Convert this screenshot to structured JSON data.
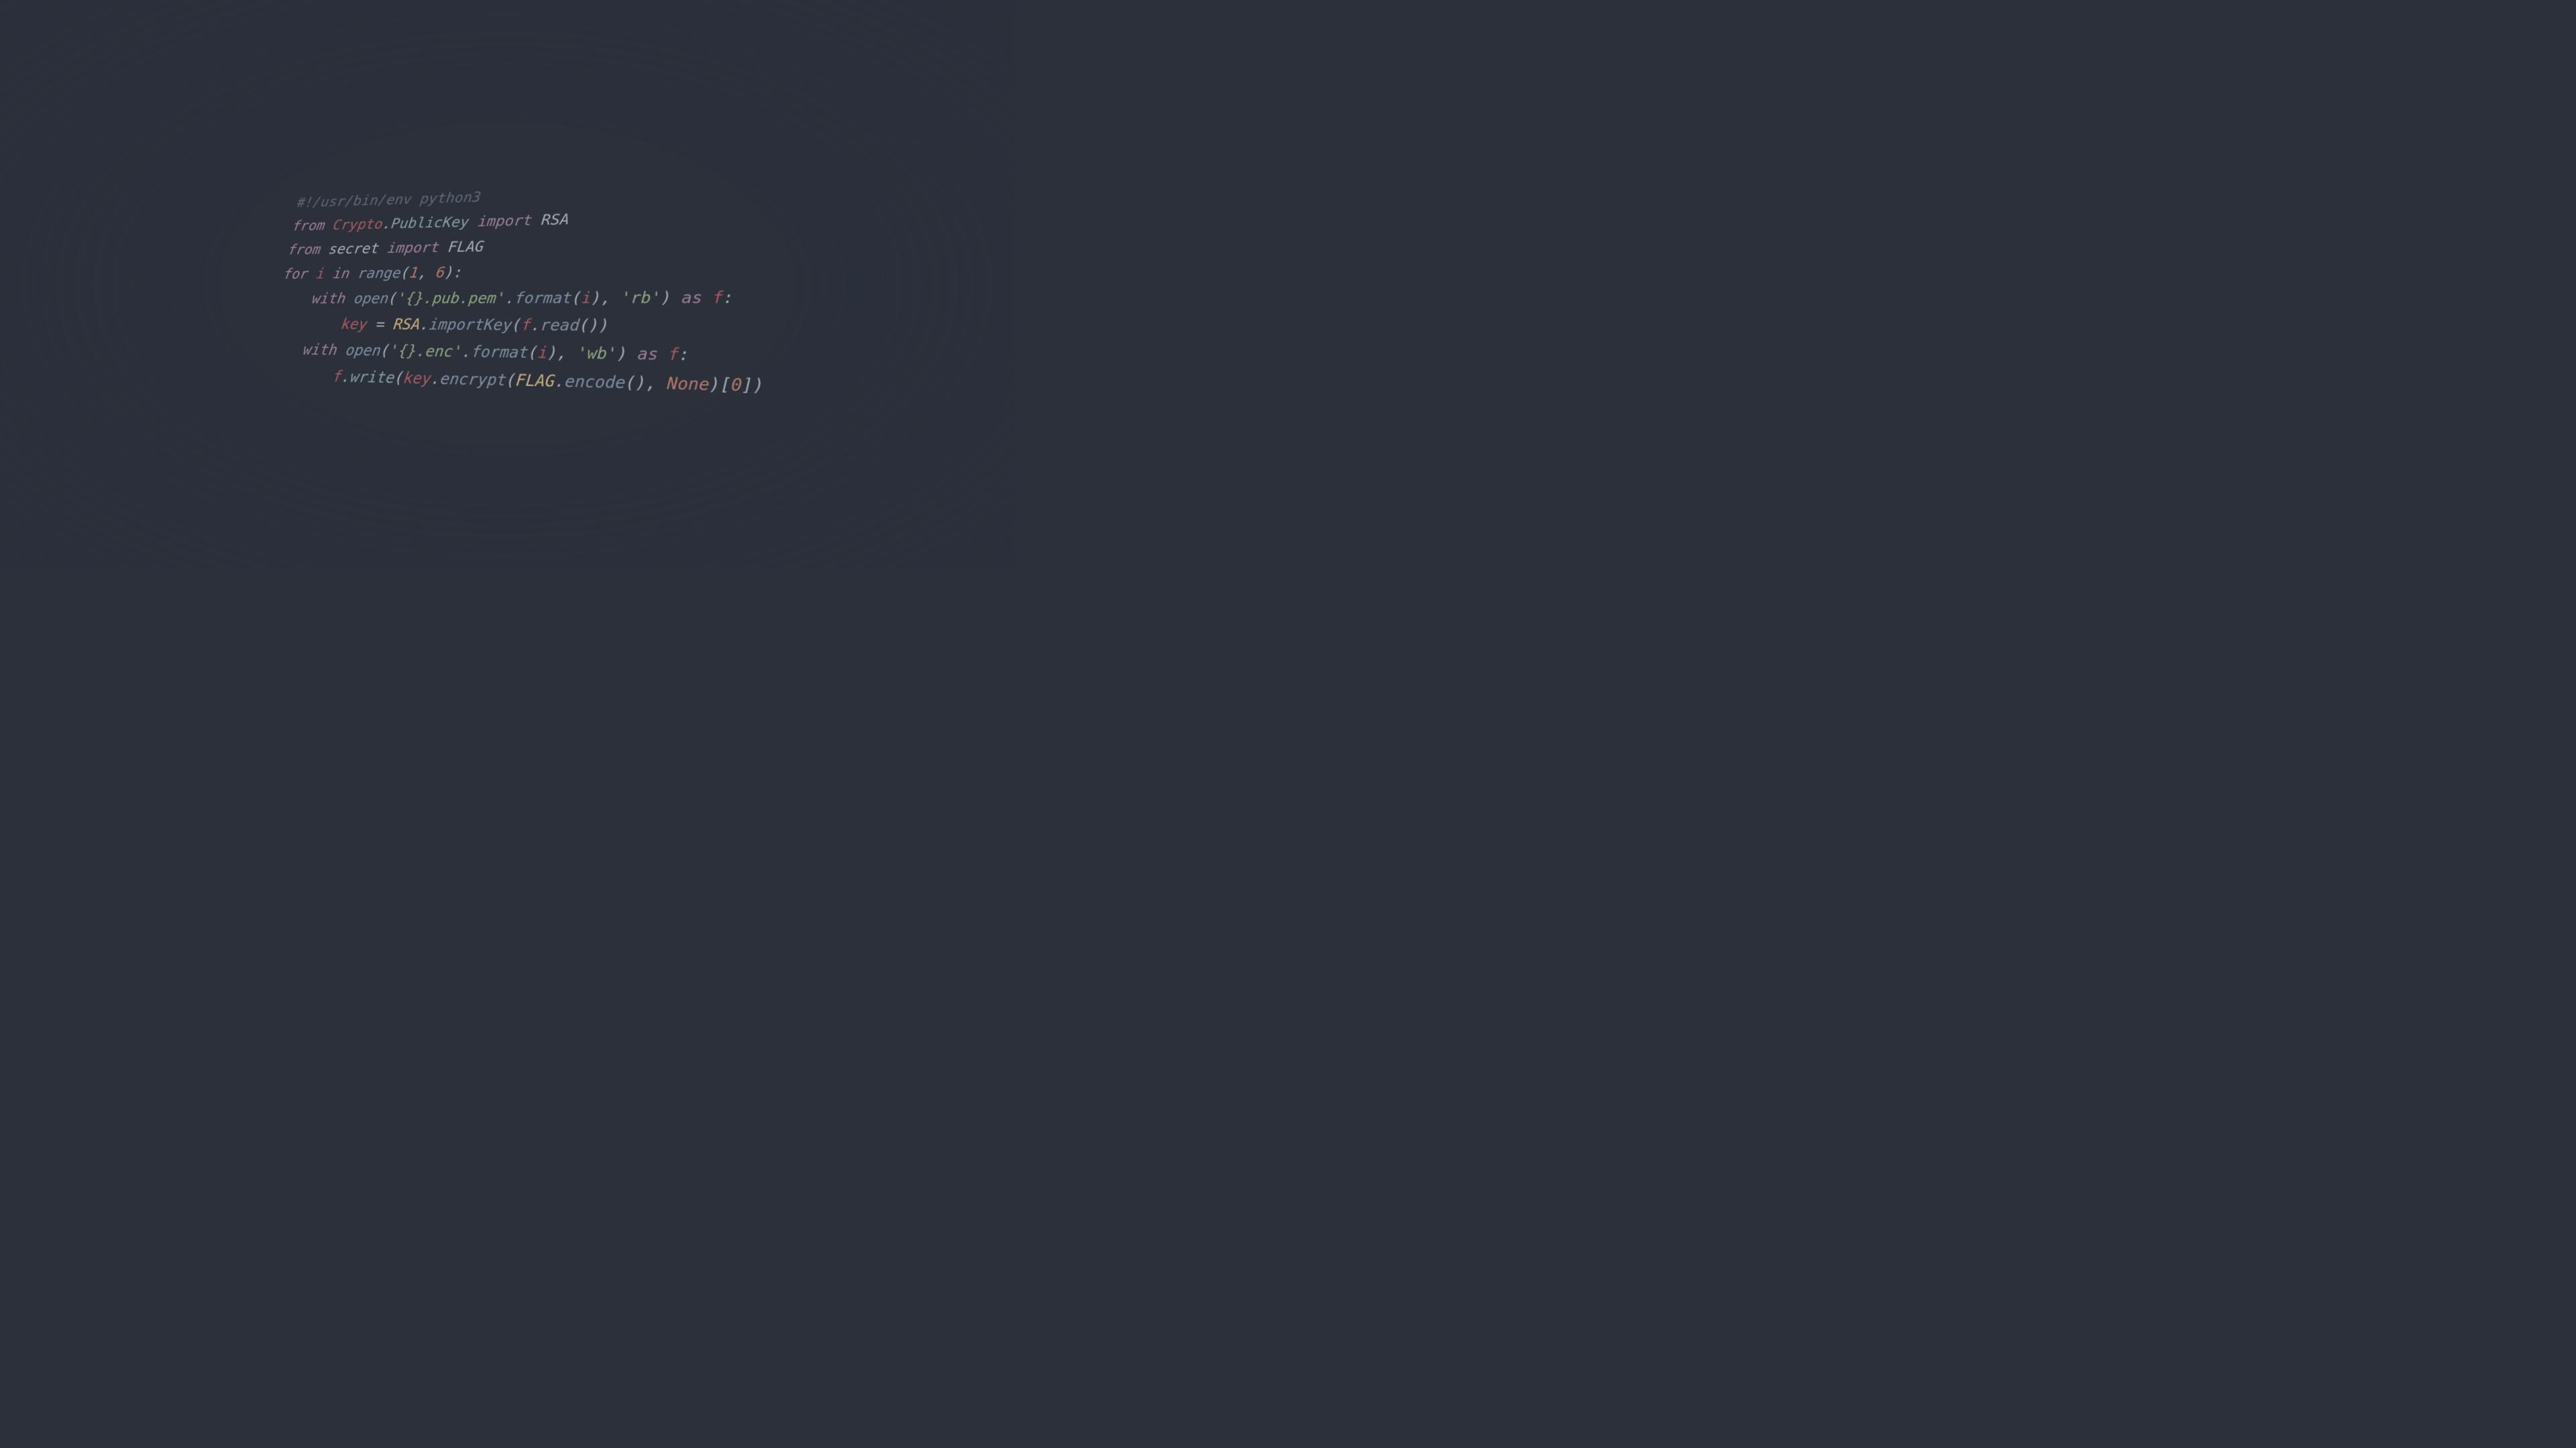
{
  "code": {
    "lines": [
      {
        "indent": 0,
        "tokens": [
          {
            "t": "#!/usr/bin/env python3",
            "c": "c-comment"
          }
        ]
      },
      {
        "indent": 0,
        "tokens": [
          {
            "t": "from ",
            "c": "c-kw"
          },
          {
            "t": "Crypto",
            "c": "c-red"
          },
          {
            "t": ".",
            "c": "c-plain"
          },
          {
            "t": "PublicKey",
            "c": "c-teal"
          },
          {
            "t": " import ",
            "c": "c-kw"
          },
          {
            "t": "RSA",
            "c": "c-plain"
          }
        ]
      },
      {
        "indent": 0,
        "tokens": [
          {
            "t": "from ",
            "c": "c-kw"
          },
          {
            "t": "secret",
            "c": "c-plain"
          },
          {
            "t": " import ",
            "c": "c-kw"
          },
          {
            "t": "FLAG",
            "c": "c-plain"
          }
        ]
      },
      {
        "indent": 0,
        "tokens": [
          {
            "t": "",
            "c": "c-plain"
          }
        ]
      },
      {
        "indent": 0,
        "tokens": [
          {
            "t": "for ",
            "c": "c-kw"
          },
          {
            "t": "i",
            "c": "c-red"
          },
          {
            "t": " in ",
            "c": "c-kw"
          },
          {
            "t": "range",
            "c": "c-blue"
          },
          {
            "t": "(",
            "c": "c-plain"
          },
          {
            "t": "1",
            "c": "c-num"
          },
          {
            "t": ", ",
            "c": "c-plain"
          },
          {
            "t": "6",
            "c": "c-num"
          },
          {
            "t": "):",
            "c": "c-plain"
          }
        ]
      },
      {
        "indent": 1,
        "tokens": [
          {
            "t": "with ",
            "c": "c-kw"
          },
          {
            "t": "open",
            "c": "c-blue"
          },
          {
            "t": "(",
            "c": "c-plain"
          },
          {
            "t": "'{}.pub.pem'",
            "c": "c-str"
          },
          {
            "t": ".",
            "c": "c-plain"
          },
          {
            "t": "format",
            "c": "c-blue"
          },
          {
            "t": "(",
            "c": "c-plain"
          },
          {
            "t": "i",
            "c": "c-red"
          },
          {
            "t": "), ",
            "c": "c-plain"
          },
          {
            "t": "'rb'",
            "c": "c-str"
          },
          {
            "t": ") ",
            "c": "c-plain"
          },
          {
            "t": "as ",
            "c": "c-kw"
          },
          {
            "t": "f",
            "c": "c-red"
          },
          {
            "t": ":",
            "c": "c-plain"
          }
        ]
      },
      {
        "indent": 2,
        "tokens": [
          {
            "t": "key",
            "c": "c-red"
          },
          {
            "t": " = ",
            "c": "c-plain"
          },
          {
            "t": "RSA",
            "c": "c-yellow"
          },
          {
            "t": ".",
            "c": "c-plain"
          },
          {
            "t": "importKey",
            "c": "c-blue"
          },
          {
            "t": "(",
            "c": "c-plain"
          },
          {
            "t": "f",
            "c": "c-red"
          },
          {
            "t": ".",
            "c": "c-plain"
          },
          {
            "t": "read",
            "c": "c-blue"
          },
          {
            "t": "())",
            "c": "c-plain"
          }
        ]
      },
      {
        "indent": 1,
        "tokens": [
          {
            "t": "with ",
            "c": "c-kw"
          },
          {
            "t": "open",
            "c": "c-blue"
          },
          {
            "t": "(",
            "c": "c-plain"
          },
          {
            "t": "'{}.enc'",
            "c": "c-str"
          },
          {
            "t": ".",
            "c": "c-plain"
          },
          {
            "t": "format",
            "c": "c-blue"
          },
          {
            "t": "(",
            "c": "c-plain"
          },
          {
            "t": "i",
            "c": "c-red"
          },
          {
            "t": "), ",
            "c": "c-plain"
          },
          {
            "t": "'wb'",
            "c": "c-str"
          },
          {
            "t": ") ",
            "c": "c-plain"
          },
          {
            "t": "as ",
            "c": "c-kw"
          },
          {
            "t": "f",
            "c": "c-red"
          },
          {
            "t": ":",
            "c": "c-plain"
          }
        ]
      },
      {
        "indent": 2,
        "tokens": [
          {
            "t": "f",
            "c": "c-red"
          },
          {
            "t": ".",
            "c": "c-plain"
          },
          {
            "t": "write",
            "c": "c-teal"
          },
          {
            "t": "(",
            "c": "c-plain"
          },
          {
            "t": "key",
            "c": "c-red"
          },
          {
            "t": ".",
            "c": "c-plain"
          },
          {
            "t": "encrypt",
            "c": "c-blue"
          },
          {
            "t": "(",
            "c": "c-plain"
          },
          {
            "t": "FLAG",
            "c": "c-yellow"
          },
          {
            "t": ".",
            "c": "c-plain"
          },
          {
            "t": "encode",
            "c": "c-blue"
          },
          {
            "t": "(), ",
            "c": "c-plain"
          },
          {
            "t": "None",
            "c": "c-num"
          },
          {
            "t": ")[",
            "c": "c-plain"
          },
          {
            "t": "0",
            "c": "c-num"
          },
          {
            "t": "])",
            "c": "c-plain"
          }
        ]
      }
    ]
  }
}
